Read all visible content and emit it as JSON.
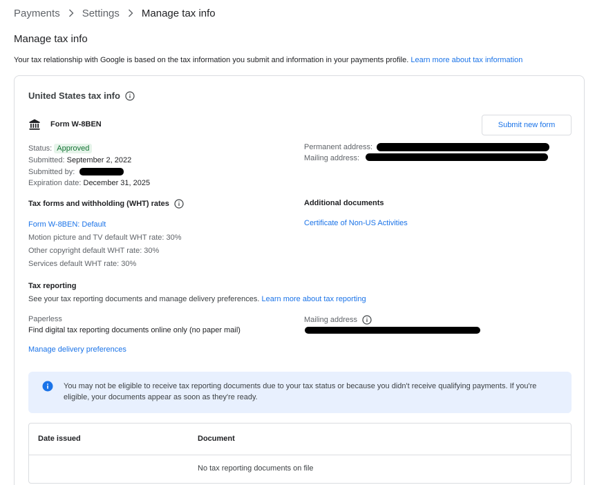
{
  "breadcrumb": {
    "items": [
      "Payments",
      "Settings",
      "Manage tax info"
    ]
  },
  "page": {
    "title": "Manage tax info",
    "intro": "Your tax relationship with Google is based on the tax information you submit and information in your payments profile.",
    "intro_link": "Learn more about tax information"
  },
  "card": {
    "title": "United States tax info",
    "form_name": "Form W-8BEN",
    "submit_button": "Submit new form",
    "status_label": "Status:",
    "status_value": "Approved",
    "submitted_label": "Submitted:",
    "submitted_value": "September 2, 2022",
    "submitted_by_label": "Submitted by:",
    "expiration_label": "Expiration date:",
    "expiration_value": "December 31, 2025",
    "permanent_address_label": "Permanent address:",
    "mailing_address_label": "Mailing address:"
  },
  "wht": {
    "title": "Tax forms and withholding (WHT) rates",
    "form_link": "Form W-8BEN: Default",
    "rates": [
      "Motion picture and TV default WHT rate: 30%",
      "Other copyright default WHT rate: 30%",
      "Services default WHT rate: 30%"
    ]
  },
  "additional": {
    "title": "Additional documents",
    "link": "Certificate of Non-US Activities"
  },
  "reporting": {
    "title": "Tax reporting",
    "desc": "See your tax reporting documents and manage delivery preferences.",
    "desc_link": "Learn more about tax reporting",
    "paperless_label": "Paperless",
    "paperless_value": "Find digital tax reporting documents online only (no paper mail)",
    "mailing_label": "Mailing address",
    "manage_link": "Manage delivery preferences"
  },
  "notice": {
    "text": "You may not be eligible to receive tax reporting documents due to your tax status or because you didn't receive qualifying payments. If you're eligible, your documents appear as soon as they're ready."
  },
  "documents_table": {
    "columns": [
      "Date issued",
      "Document"
    ],
    "empty_text": "No tax reporting documents on file"
  },
  "colors": {
    "link": "#1a73e8",
    "approved_bg": "#e6f4ea",
    "approved_text": "#137333",
    "notice_bg": "#e8f0fe"
  },
  "icons": {
    "bank": "bank-icon",
    "info": "info-icon",
    "info_filled": "info-filled-icon",
    "chevron": "chevron-right-icon"
  }
}
